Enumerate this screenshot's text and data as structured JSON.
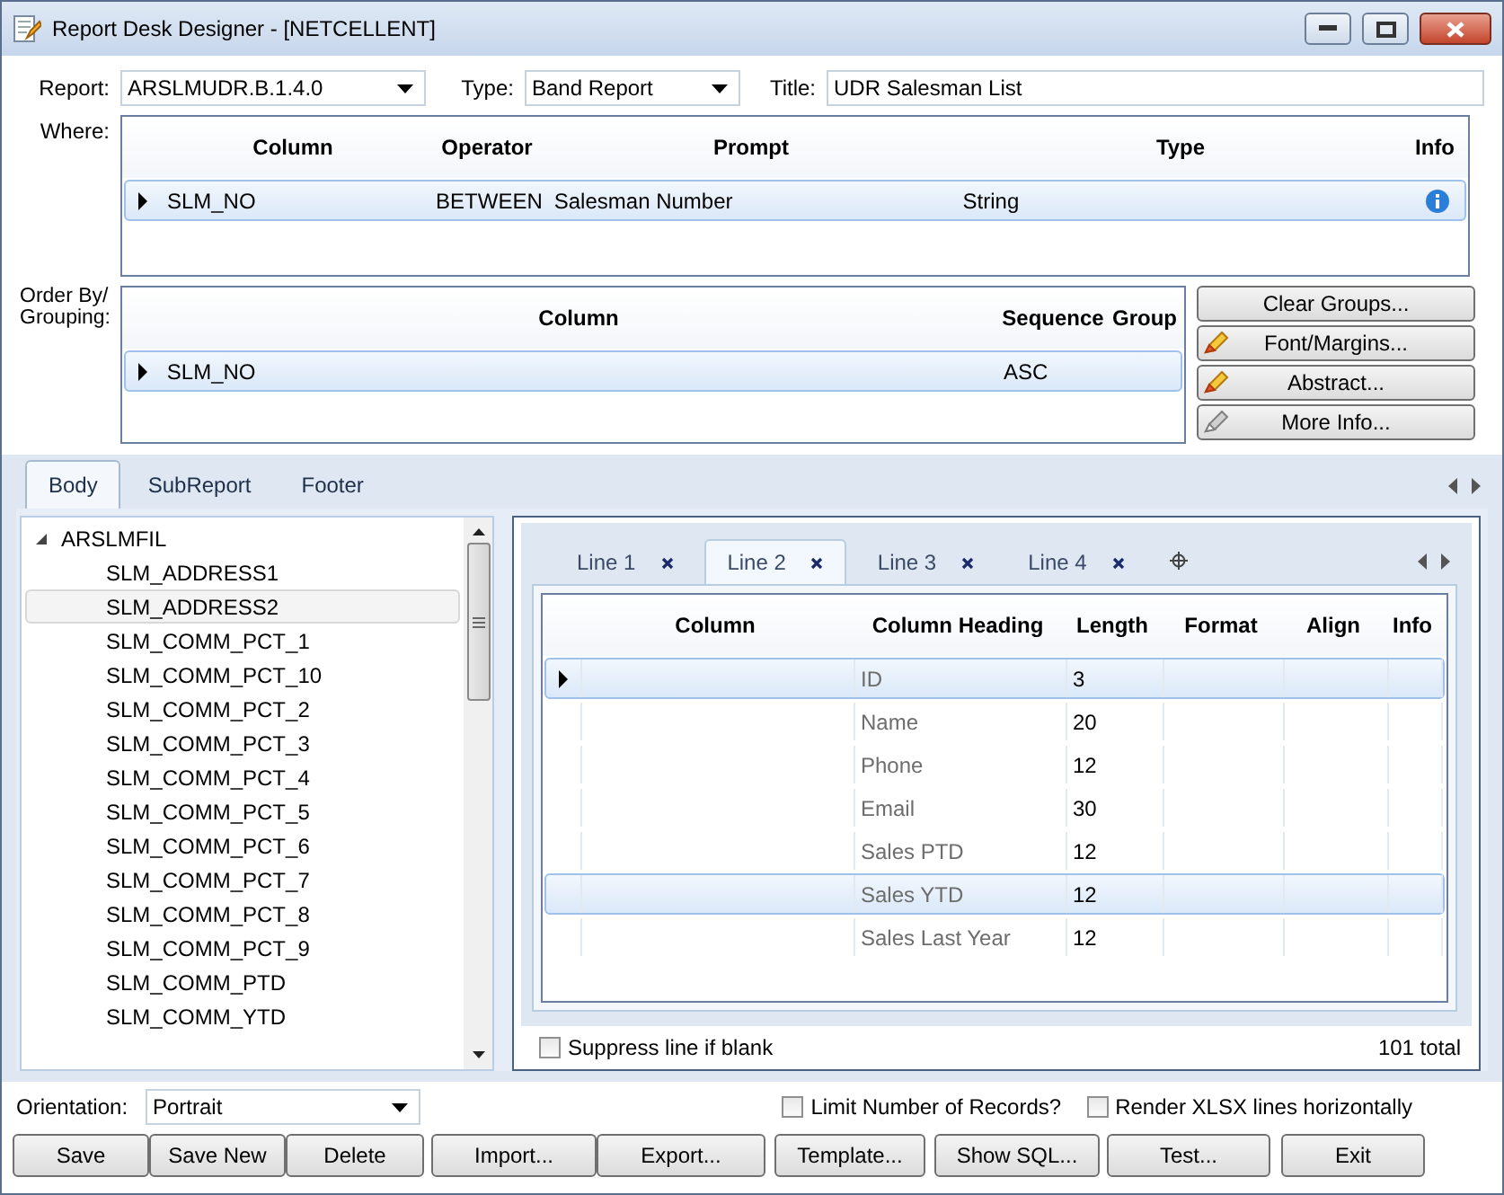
{
  "window": {
    "title": "Report Desk Designer - [NETCELLENT]"
  },
  "report": {
    "label": "Report:",
    "value": "ARSLMUDR.B.1.4.0"
  },
  "type": {
    "label": "Type:",
    "value": "Band Report"
  },
  "title_field": {
    "label": "Title:",
    "value": "UDR Salesman List"
  },
  "where": {
    "label": "Where:",
    "columns": [
      "Column",
      "Operator",
      "Prompt",
      "Type",
      "Info"
    ],
    "rows": [
      {
        "cells": [
          "SLM_NO",
          "BETWEEN",
          "Salesman Number",
          "String"
        ],
        "info": true,
        "current": true,
        "selected": true
      }
    ]
  },
  "order_by": {
    "label": "Order By/ Grouping:",
    "columns": [
      "Column",
      "Sequence",
      "Group"
    ],
    "rows": [
      {
        "cells": [
          "SLM_NO",
          "ASC"
        ],
        "current": true,
        "selected": true
      }
    ]
  },
  "side_buttons": [
    {
      "label": "Clear Groups...",
      "kind": "plain"
    },
    {
      "label": "Font/Margins...",
      "kind": "pencil"
    },
    {
      "label": "Abstract...",
      "kind": "pencil"
    },
    {
      "label": "More Info...",
      "kind": "pencil-grey"
    }
  ],
  "body_tabs": [
    {
      "label": "Body",
      "selected": true
    },
    {
      "label": "SubReport",
      "selected": false
    },
    {
      "label": "Footer",
      "selected": false
    }
  ],
  "tree": {
    "root": "ARSLMFIL",
    "expanded": true,
    "items": [
      {
        "label": "SLM_ADDRESS1",
        "selected": false
      },
      {
        "label": "SLM_ADDRESS2",
        "selected": true
      },
      {
        "label": "SLM_COMM_PCT_1",
        "selected": false
      },
      {
        "label": "SLM_COMM_PCT_10",
        "selected": false
      },
      {
        "label": "SLM_COMM_PCT_2",
        "selected": false
      },
      {
        "label": "SLM_COMM_PCT_3",
        "selected": false
      },
      {
        "label": "SLM_COMM_PCT_4",
        "selected": false
      },
      {
        "label": "SLM_COMM_PCT_5",
        "selected": false
      },
      {
        "label": "SLM_COMM_PCT_6",
        "selected": false
      },
      {
        "label": "SLM_COMM_PCT_7",
        "selected": false
      },
      {
        "label": "SLM_COMM_PCT_8",
        "selected": false
      },
      {
        "label": "SLM_COMM_PCT_9",
        "selected": false
      },
      {
        "label": "SLM_COMM_PTD",
        "selected": false
      },
      {
        "label": "SLM_COMM_YTD",
        "selected": false
      }
    ]
  },
  "line_tabs": [
    {
      "label": "Line 1",
      "selected": false
    },
    {
      "label": "Line 2",
      "selected": true
    },
    {
      "label": "Line 3",
      "selected": false
    },
    {
      "label": "Line 4",
      "selected": false
    }
  ],
  "columns_grid": {
    "columns": [
      "Column",
      "Column Heading",
      "Length",
      "Format",
      "Align",
      "Info"
    ],
    "rows": [
      {
        "heading": "ID",
        "length": "3",
        "current": true,
        "selected": true
      },
      {
        "heading": "Name",
        "length": "20",
        "current": false,
        "selected": false
      },
      {
        "heading": "Phone",
        "length": "12",
        "current": false,
        "selected": false
      },
      {
        "heading": "Email",
        "length": "30",
        "current": false,
        "selected": false
      },
      {
        "heading": "Sales PTD",
        "length": "12",
        "current": false,
        "selected": false
      },
      {
        "heading": "Sales YTD",
        "length": "12",
        "current": false,
        "selected": true
      },
      {
        "heading": "Sales Last Year",
        "length": "12",
        "current": false,
        "selected": false
      }
    ]
  },
  "suppress": {
    "label": "Suppress line if blank",
    "checked": false
  },
  "total": "101 total",
  "orientation": {
    "label": "Orientation:",
    "value": "Portrait"
  },
  "options": [
    {
      "label": "Limit Number of Records?",
      "checked": false
    },
    {
      "label": "Render XLSX lines horizontally",
      "checked": false
    }
  ],
  "buttons": [
    "Save",
    "Save New",
    "Delete",
    "Import...",
    "Export...",
    "Template...",
    "Show SQL...",
    "Test...",
    "Exit"
  ]
}
